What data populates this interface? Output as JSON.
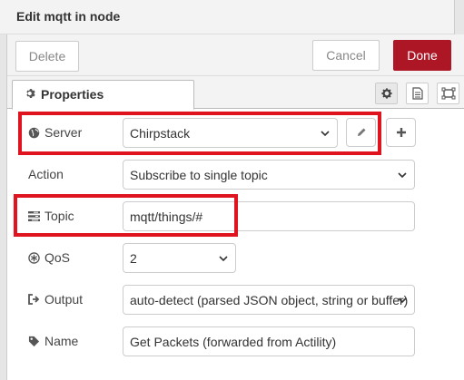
{
  "dialog": {
    "title": "Edit mqtt in node"
  },
  "toolbar": {
    "delete_label": "Delete",
    "cancel_label": "Cancel",
    "done_label": "Done"
  },
  "tabs": {
    "properties_label": "Properties",
    "icons": [
      "gear-icon",
      "description-icon",
      "appearance-icon"
    ]
  },
  "form": {
    "server": {
      "label": "Server",
      "value": "Chirpstack",
      "icon": "globe-icon"
    },
    "action": {
      "label": "Action",
      "value": "Subscribe to single topic"
    },
    "topic": {
      "label": "Topic",
      "value": "mqtt/things/#",
      "icon": "tasks-icon"
    },
    "qos": {
      "label": "QoS",
      "value": "2",
      "icon": "qos-icon"
    },
    "output": {
      "label": "Output",
      "value": "auto-detect (parsed JSON object, string or buffer)",
      "icon": "sign-out-icon"
    },
    "name": {
      "label": "Name",
      "value": "Get Packets (forwarded from Actility)",
      "icon": "tag-icon"
    }
  },
  "colors": {
    "done_button": "#ad1625",
    "highlight_box": "#e0141e"
  }
}
